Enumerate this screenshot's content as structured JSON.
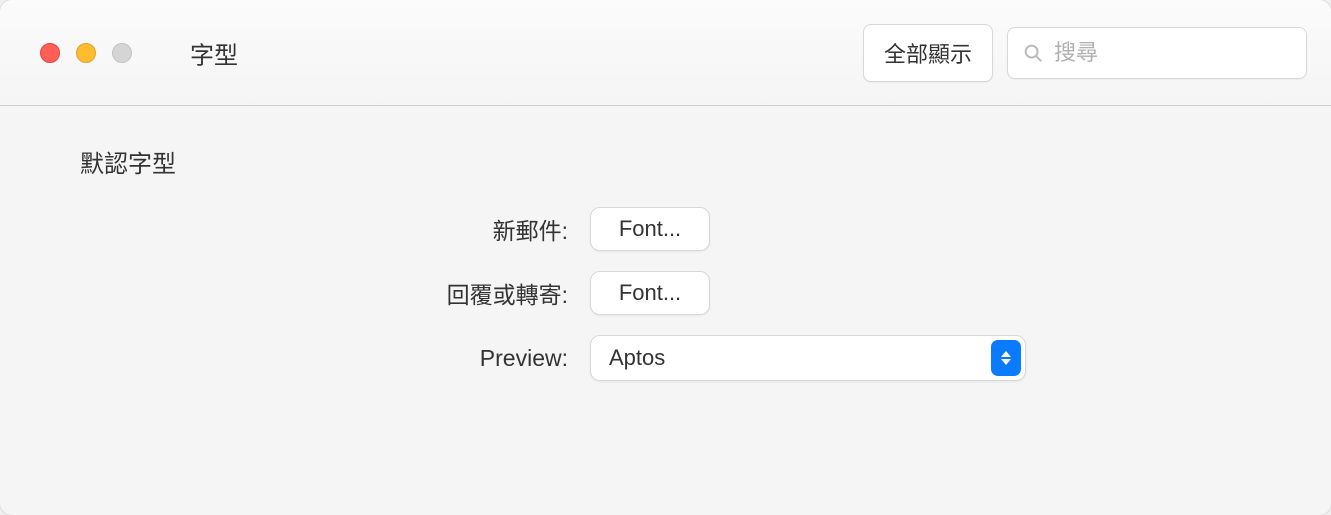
{
  "window": {
    "title": "字型"
  },
  "toolbar": {
    "show_all_label": "全部顯示",
    "search_placeholder": "搜尋"
  },
  "section": {
    "title": "默認字型"
  },
  "rows": {
    "new_mail": {
      "label": "新郵件:",
      "button": "Font..."
    },
    "reply_forward": {
      "label": "回覆或轉寄:",
      "button": "Font..."
    },
    "preview": {
      "label": "Preview:",
      "selected": "Aptos"
    }
  }
}
